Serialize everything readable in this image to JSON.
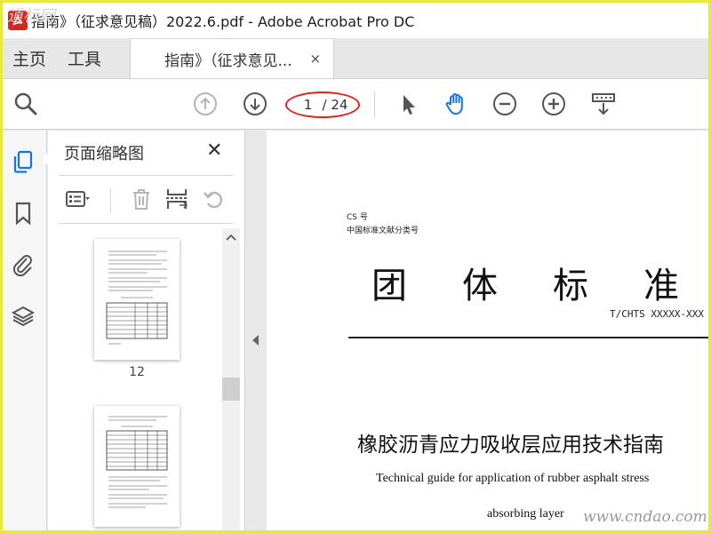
{
  "window": {
    "title": "指南》（征求意见稿）2022.6.pdf - Adobe Acrobat Pro DC",
    "border_color": "#e8ea3b"
  },
  "menu": {
    "home": "主页",
    "tools": "工具"
  },
  "tab": {
    "label": "指南》（征求意见...",
    "close": "×"
  },
  "toolbar": {
    "page_current": "1",
    "page_total": "/ 24",
    "accent": "#1473e6",
    "highlight_color": "#e0201c"
  },
  "sidebar": {
    "icons": [
      "pages-icon",
      "bookmark-icon",
      "attachment-icon",
      "layers-icon"
    ]
  },
  "thumbnail_panel": {
    "title": "页面缩略图",
    "close": "✕",
    "thumbnails": [
      {
        "label": "12"
      },
      {
        "label": ""
      }
    ]
  },
  "document": {
    "cs_number": "CS 号",
    "ccs_number": "中国标准文献分类号",
    "main_heading": "团体标准",
    "standard_code": "T/CHTS XXXXX-XXX",
    "title_cn": "橡胶沥青应力吸收层应用技术指南",
    "title_en_line1": "Technical guide for application of rubber asphalt stress",
    "title_en_line2": "absorbing layer"
  },
  "watermark": {
    "top_left": "道标网",
    "bottom_right": "www.cndao.com"
  }
}
